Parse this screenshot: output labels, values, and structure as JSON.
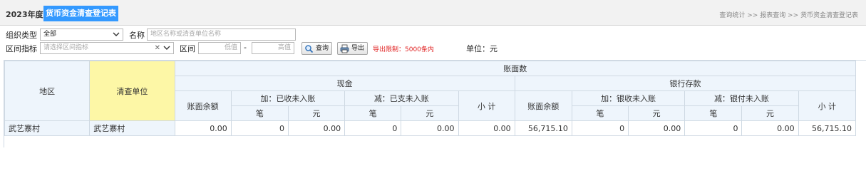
{
  "header": {
    "year": "2023年度",
    "title": "货币资金清查登记表",
    "breadcrumb": "查询统计 >> 报表查询 >> 货币资金清查登记表"
  },
  "filters": {
    "org_type_label": "组织类型",
    "org_type_value": "全部",
    "name_label": "名称",
    "name_placeholder": "地区名称或清查单位名称",
    "range_indicator_label": "区间指标",
    "range_indicator_placeholder": "请选择区间指标",
    "clear_symbol": "✕",
    "range_label": "区间",
    "low_placeholder": "低值",
    "range_dash": "-",
    "high_placeholder": "高值",
    "query_button": "查询",
    "export_button": "导出",
    "export_limit": "导出限制：5000条内",
    "unit": "单位：元"
  },
  "table": {
    "col_region": "地区",
    "col_unit": "清查单位",
    "group_book": "账面数",
    "group_cash": "现金",
    "group_bank": "银行存款",
    "col_book_balance": "账面余额",
    "col_cash_add": "加：已收未入账",
    "col_cash_sub": "减：已支未入账",
    "col_bank_add": "加：银收未入账",
    "col_bank_sub": "减：银付未入账",
    "col_subtotal": "小 计",
    "col_count": "笔",
    "col_amount": "元",
    "rows": [
      {
        "region": "武艺寨村",
        "unit": "武艺寨村",
        "cash_balance": "0.00",
        "cash_add_count": "0",
        "cash_add_amount": "0.00",
        "cash_sub_count": "0",
        "cash_sub_amount": "0.00",
        "cash_subtotal": "0.00",
        "bank_balance": "56,715.10",
        "bank_add_count": "0",
        "bank_add_amount": "0.00",
        "bank_sub_count": "0",
        "bank_sub_amount": "0.00",
        "bank_subtotal": "56,715.10"
      }
    ]
  },
  "colors": {
    "title_highlight": "#3399ff",
    "header_bg": "#eef5fc",
    "unit_header_bg": "#fdf7a6",
    "warning": "#e02020"
  },
  "icons": {
    "dropdown": "chevron-down-icon",
    "clear": "close-icon",
    "query": "search-icon",
    "export": "printer-icon"
  }
}
